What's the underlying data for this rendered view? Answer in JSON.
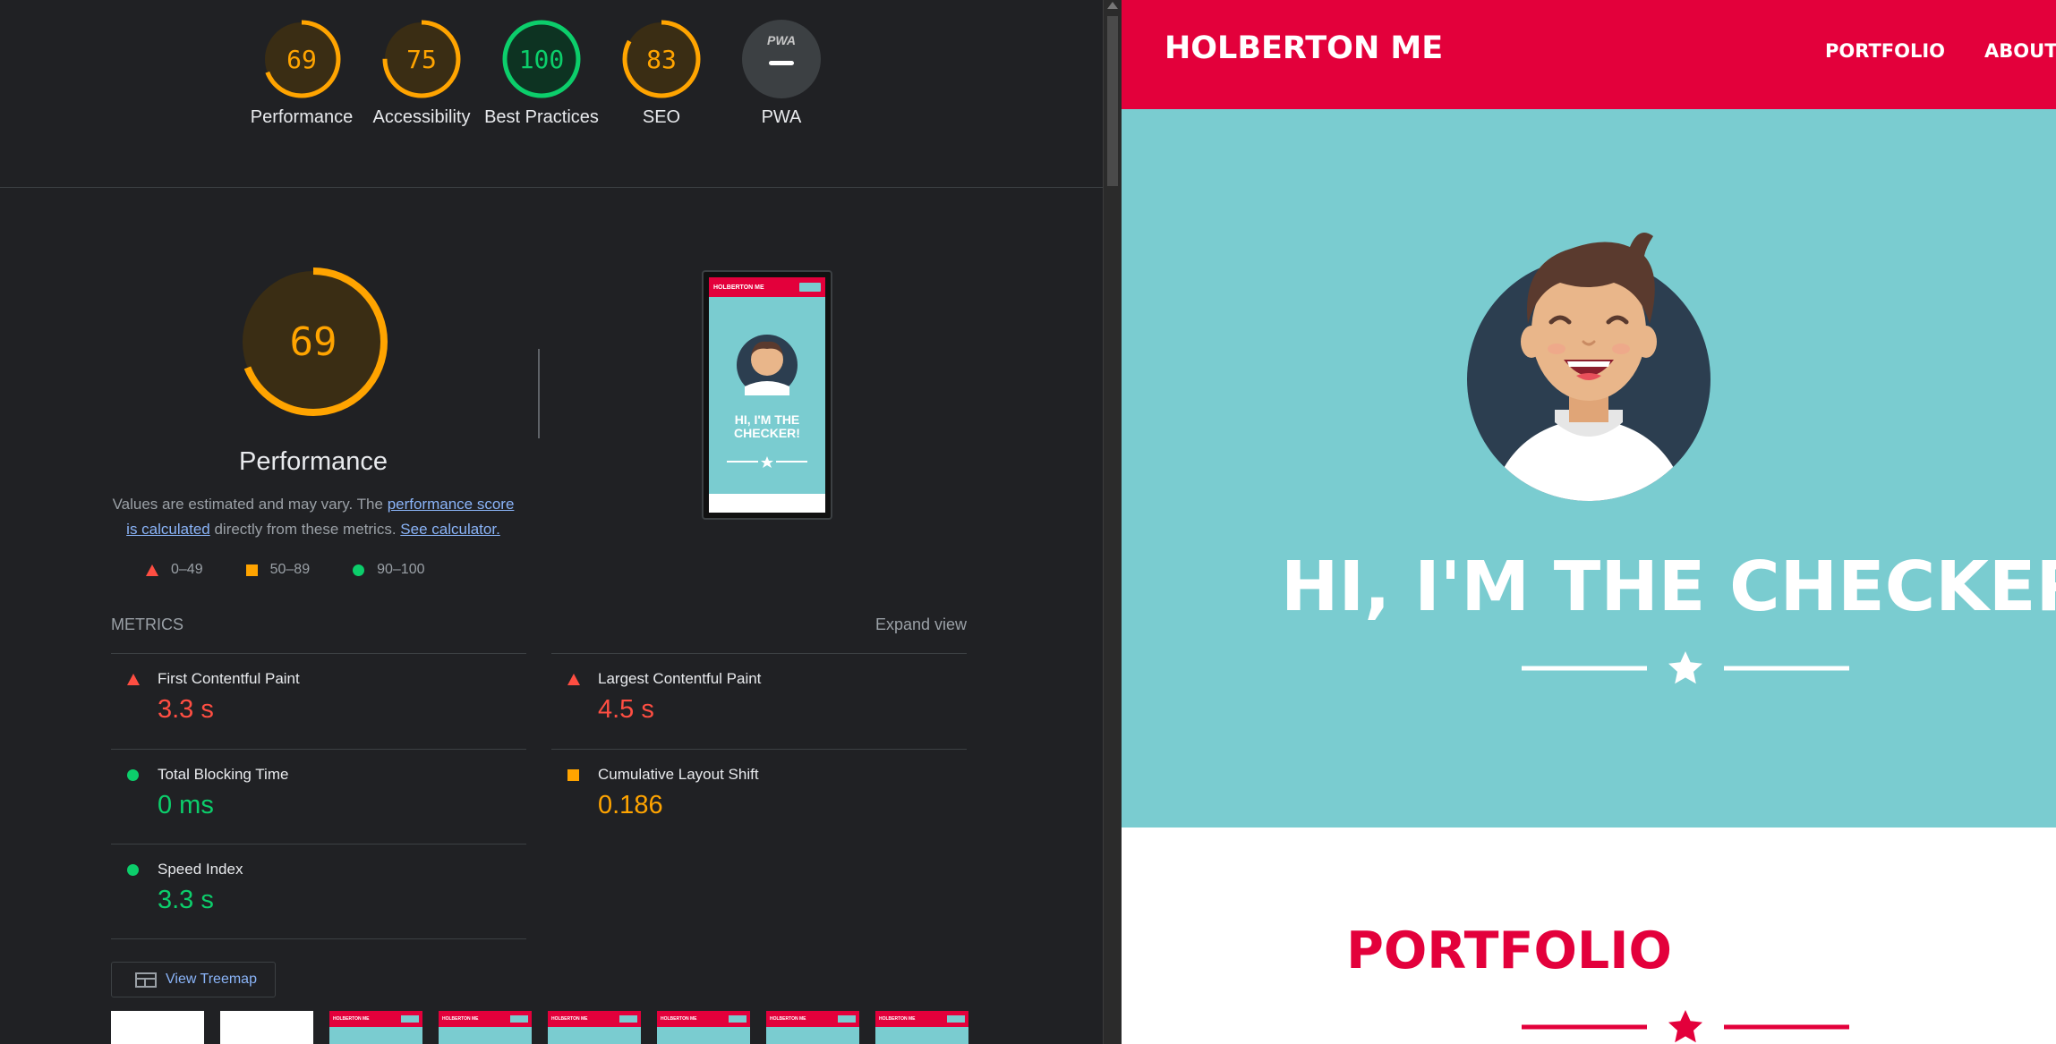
{
  "lighthouse": {
    "categories": [
      {
        "label": "Performance",
        "score": 69,
        "color": "#ffa400"
      },
      {
        "label": "Accessibility",
        "score": 75,
        "color": "#ffa400"
      },
      {
        "label": "Best Practices",
        "score": 100,
        "color": "#0cce6b"
      },
      {
        "label": "SEO",
        "score": 83,
        "color": "#ffa400"
      },
      {
        "label": "PWA",
        "score": null,
        "badge": "PWA"
      }
    ],
    "performance": {
      "score": "69",
      "title": "Performance",
      "desc_prefix": "Values are estimated and may vary. The ",
      "desc_link1": "performance score is calculated",
      "desc_middle": " directly from these metrics. ",
      "desc_link2": "See calculator."
    },
    "legend": [
      {
        "range": "0–49"
      },
      {
        "range": "50–89"
      },
      {
        "range": "90–100"
      }
    ],
    "metrics_label": "METRICS",
    "expand_label": "Expand view",
    "metrics": [
      {
        "name": "First Contentful Paint",
        "value": "3.3 s",
        "status": "red"
      },
      {
        "name": "Largest Contentful Paint",
        "value": "4.5 s",
        "status": "red"
      },
      {
        "name": "Total Blocking Time",
        "value": "0 ms",
        "status": "green"
      },
      {
        "name": "Cumulative Layout Shift",
        "value": "0.186",
        "status": "orange"
      },
      {
        "name": "Speed Index",
        "value": "3.3 s",
        "status": "green"
      }
    ],
    "treemap_label": "View Treemap",
    "thumb_brand": "HOLBERTON ME"
  },
  "preview": {
    "brand": "HOLBERTON ME",
    "hero_title": "HI, I'M THE CHECKER!"
  },
  "site": {
    "brand": "HOLBERTON ME",
    "nav": [
      "PORTFOLIO",
      "ABOUT"
    ],
    "hero_title": "HI, I'M THE CHECKER!",
    "portfolio_title": "PORTFOLIO",
    "colors": {
      "header": "#e3003b",
      "hero": "#7accd0",
      "avatar_bg": "#2c3e50"
    }
  }
}
